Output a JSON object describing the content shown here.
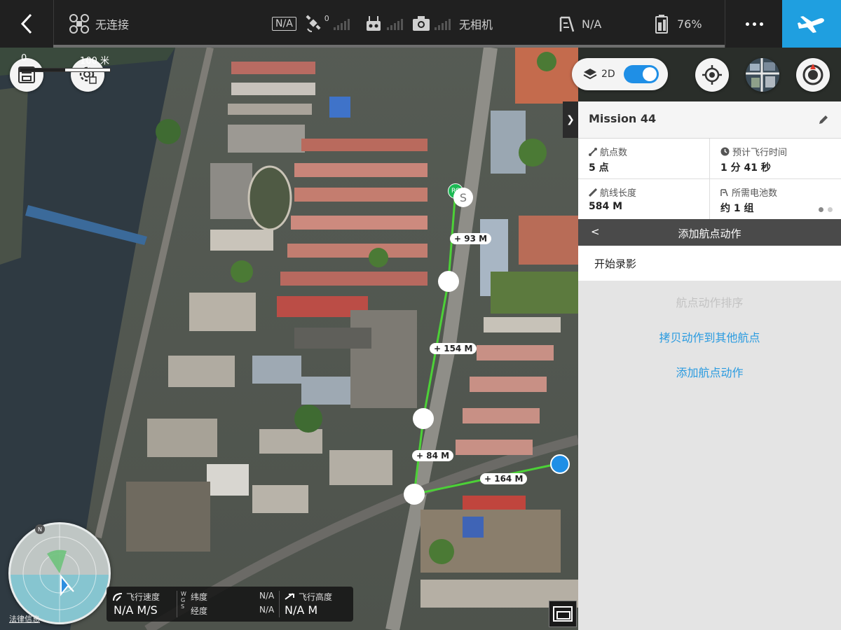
{
  "topbar": {
    "connection": "无连接",
    "gps_badge": "N/A",
    "satellites": "0",
    "camera": "无相机",
    "altitude_limit": "N/A",
    "battery": "76%"
  },
  "map": {
    "scale_start": "0",
    "scale_end": "100 米",
    "mode_label": "2D",
    "mode_2d_enabled": true,
    "segment_labels": [
      "+ 93 M",
      "+ 154 M",
      "+ 84 M",
      "+ 164 M"
    ],
    "home_marker": "RC",
    "start_marker": "S",
    "legal_link": "法律信息",
    "compass_north": "N"
  },
  "telemetry": {
    "speed_label": "飞行速度",
    "speed_value": "N/A M/S",
    "wgs_label": "W G S",
    "lat_label": "纬度",
    "lat_value": "N/A",
    "lng_label": "经度",
    "lng_value": "N/A",
    "alt_label": "飞行高度",
    "alt_value": "N/A M"
  },
  "mission": {
    "title": "Mission 44",
    "waypoints_label": "航点数",
    "waypoints_value": "5 点",
    "flight_time_label": "预计飞行时间",
    "flight_time_value": "1 分 41 秒",
    "route_length_label": "航线长度",
    "route_length_value": "584 M",
    "batteries_label": "所需电池数",
    "batteries_value": "约 1 组"
  },
  "actions": {
    "back": "<",
    "header": "添加航点动作",
    "item": "开始录影",
    "sort_link": "航点动作排序",
    "copy_link": "拷贝动作到其他航点",
    "add_link": "添加航点动作"
  },
  "colors": {
    "accent": "#1f9fe0",
    "route": "#4cd137",
    "topbar": "#202020"
  }
}
